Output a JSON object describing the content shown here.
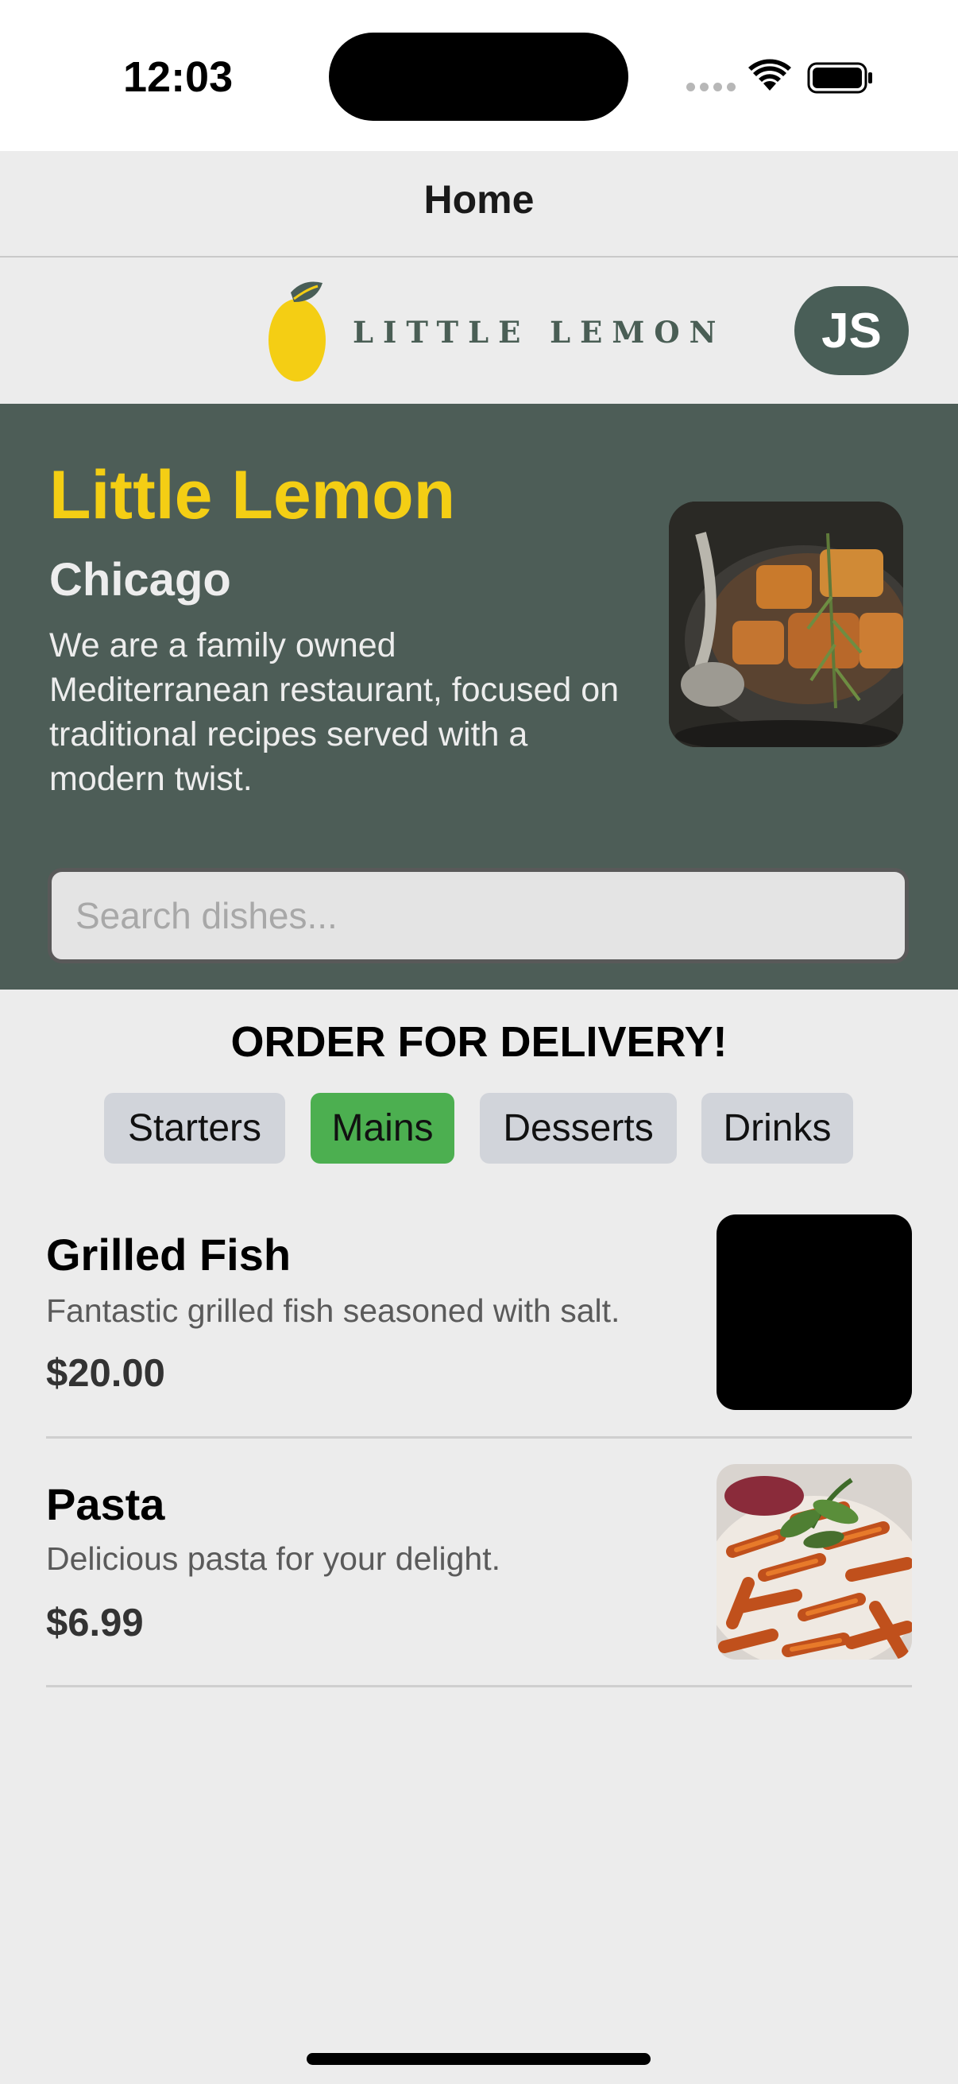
{
  "status_bar": {
    "time": "12:03"
  },
  "nav": {
    "title": "Home"
  },
  "header": {
    "logo_text": "LITTLE LEMON",
    "avatar_initials": "JS"
  },
  "hero": {
    "title": "Little Lemon",
    "city": "Chicago",
    "description": "We are a family owned Mediterranean restaurant, focused on traditional recipes served with a modern twist."
  },
  "search": {
    "placeholder": "Search dishes...",
    "value": ""
  },
  "order": {
    "heading": "ORDER FOR DELIVERY!",
    "categories": [
      {
        "label": "Starters",
        "selected": false
      },
      {
        "label": "Mains",
        "selected": true
      },
      {
        "label": "Desserts",
        "selected": false
      },
      {
        "label": "Drinks",
        "selected": false
      }
    ]
  },
  "menu_items": [
    {
      "name": "Grilled Fish",
      "description": "Fantastic grilled fish seasoned with salt.",
      "price": "$20.00"
    },
    {
      "name": "Pasta",
      "description": "Delicious pasta for your delight.",
      "price": "$6.99"
    }
  ],
  "colors": {
    "brand_green": "#495e57",
    "brand_yellow": "#f4ce14",
    "selected_category": "#4caf50"
  },
  "icons": [
    "wifi-icon",
    "battery-icon",
    "lemon-logo-icon"
  ]
}
